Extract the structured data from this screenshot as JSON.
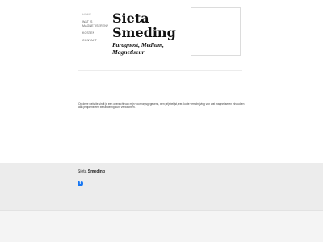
{
  "nav": {
    "items": [
      {
        "label": "HOME"
      },
      {
        "label": "WAT IS MAGNETISEREN?"
      },
      {
        "label": "KOSTEN"
      },
      {
        "label": "CONTACT"
      }
    ]
  },
  "brand": {
    "line1": "Sieta",
    "line2": "Smeding",
    "subtitle": "Paragnost, Medium, Magnetiseur"
  },
  "intro": {
    "text": "Op deze website vindt je een overzicht van mijn voorzorgsgegevens, een prijsbelijst, een korte verschrijving van wat magnetiseren inhoud en aan je tijdens een behandeling kunt verwachten."
  },
  "footer": {
    "brand_first": "Sieta",
    "brand_second": "Smeding",
    "facebook_icon": "facebook-icon",
    "facebook_color": "#1877f2"
  }
}
